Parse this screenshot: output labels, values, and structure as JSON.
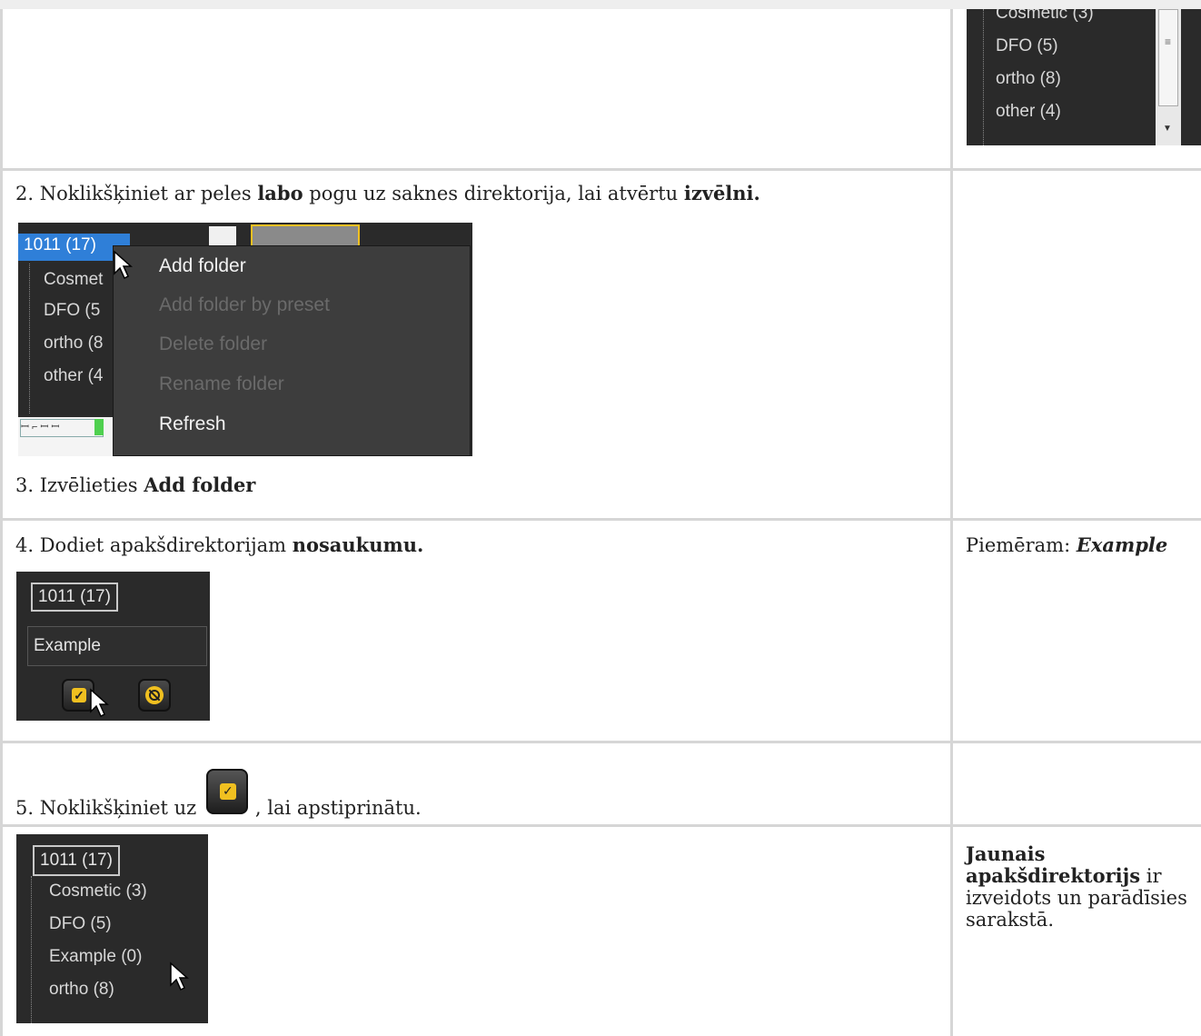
{
  "row1": {
    "tree_items": [
      "Cosmetic (3)",
      "DFO (5)",
      "ortho (8)",
      "other (4)"
    ]
  },
  "row2": {
    "step_prefix": "2. Noklikšķiniet ar peles ",
    "step_bold1": "labo",
    "step_mid": " pogu uz saknes direktorija, lai atvērtu ",
    "step_bold2": "izvēlni.",
    "tree": {
      "root": "1011 (17)",
      "items": [
        "Cosmet",
        "DFO (5",
        "ortho (8",
        "other (4"
      ]
    },
    "context_menu": {
      "add_folder": "Add folder",
      "add_folder_by_preset": "Add folder by preset",
      "delete_folder": "Delete folder",
      "rename_folder": "Rename folder",
      "refresh": "Refresh"
    },
    "step3_prefix": "3. Izvēlieties ",
    "step3_bold": "Add folder"
  },
  "row3": {
    "step_prefix": "4. Dodiet apakšdirektorijam ",
    "step_bold": "nosaukumu.",
    "side_prefix": "Piemēram: ",
    "side_bold": "Example",
    "shot": {
      "root": "1011 (17)",
      "input_value": "Example"
    }
  },
  "row4": {
    "step_prefix": "5. Noklikšķiniet uz ",
    "step_suffix": ", lai apstiprinātu."
  },
  "row5": {
    "tree": {
      "root": "1011 (17)",
      "items": [
        "Cosmetic (3)",
        "DFO (5)",
        "Example (0)",
        "ortho (8)"
      ]
    },
    "side_bold": "Jaunais apakšdirektorijs",
    "side_rest": " ir izveidots un parādīsies sarakstā."
  },
  "colors": {
    "screenshot_bg": "#2a2a2a",
    "accent_yellow": "#f0c020",
    "selection_blue": "#2f7fd8",
    "table_border": "#d6d6d6"
  }
}
